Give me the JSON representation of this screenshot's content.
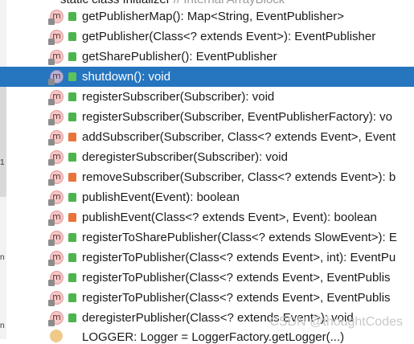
{
  "top_partial": {
    "label": "static class Initializer",
    "comment": "// Internal ArrayBlock"
  },
  "members": [
    {
      "label": "getPublisherMap(): Map<String, EventPublisher>",
      "access": "public",
      "selected": false
    },
    {
      "label": "getPublisher(Class<? extends Event>): EventPublisher",
      "access": "public",
      "selected": false
    },
    {
      "label": "getSharePublisher(): EventPublisher",
      "access": "public",
      "selected": false
    },
    {
      "label": "shutdown(): void",
      "access": "public",
      "selected": true
    },
    {
      "label": "registerSubscriber(Subscriber): void",
      "access": "public",
      "selected": false
    },
    {
      "label": "registerSubscriber(Subscriber, EventPublisherFactory): vo",
      "access": "public",
      "selected": false
    },
    {
      "label": "addSubscriber(Subscriber, Class<? extends Event>, Event",
      "access": "private",
      "selected": false
    },
    {
      "label": "deregisterSubscriber(Subscriber): void",
      "access": "public",
      "selected": false
    },
    {
      "label": "removeSubscriber(Subscriber, Class<? extends Event>): b",
      "access": "private",
      "selected": false
    },
    {
      "label": "publishEvent(Event): boolean",
      "access": "public",
      "selected": false
    },
    {
      "label": "publishEvent(Class<? extends Event>, Event): boolean",
      "access": "private",
      "selected": false
    },
    {
      "label": "registerToSharePublisher(Class<? extends SlowEvent>): E",
      "access": "public",
      "selected": false
    },
    {
      "label": "registerToPublisher(Class<? extends Event>, int): EventPu",
      "access": "public",
      "selected": false
    },
    {
      "label": "registerToPublisher(Class<? extends Event>, EventPublis",
      "access": "public",
      "selected": false
    },
    {
      "label": "registerToPublisher(Class<? extends Event>, EventPublis",
      "access": "public",
      "selected": false
    },
    {
      "label": "deregisterPublisher(Class<? extends Event>): void",
      "access": "public",
      "selected": false
    }
  ],
  "bottom_partial": {
    "label": "LOGGER: Logger = LoggerFactory.getLogger(...)"
  },
  "method_icon_letter": "m",
  "left_marks": [
    "1",
    "n",
    "n"
  ],
  "watermark": "CSDN @thoughtCodes",
  "colors": {
    "selection": "#2675bf",
    "public": "#4db44d",
    "private": "#e8743b"
  }
}
